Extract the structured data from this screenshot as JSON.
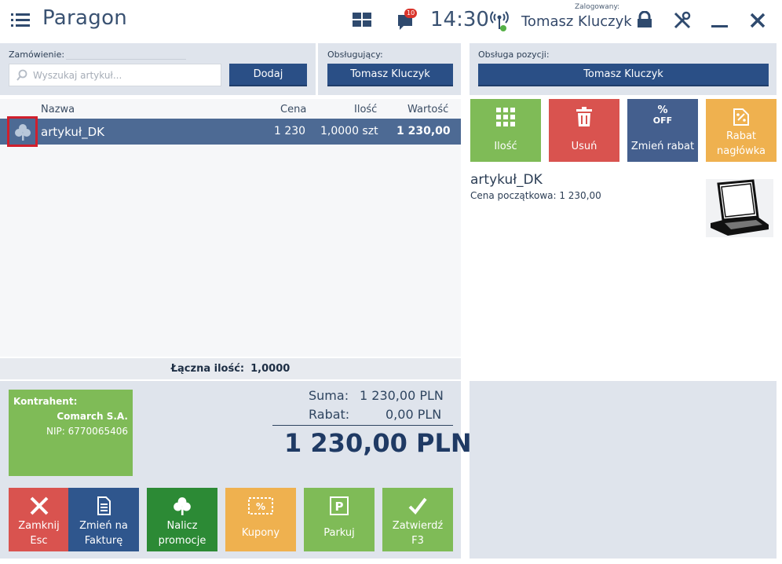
{
  "header": {
    "title": "Paragon",
    "notifications_count": "10",
    "clock": "14:30",
    "logged_label": "Zalogowany:",
    "logged_user": "Tomasz Kluczyk"
  },
  "order": {
    "label": "Zamówienie:",
    "search_placeholder": "Wyszukaj artykuł...",
    "add_button": "Dodaj"
  },
  "serving": {
    "label": "Obsługujący:",
    "user_button": "Tomasz Kluczyk"
  },
  "position_service": {
    "label": "Obsługa pozycji:",
    "user_button": "Tomasz Kluczyk"
  },
  "table": {
    "columns": [
      "Nazwa",
      "Cena",
      "Ilość",
      "Wartość"
    ],
    "rows": [
      {
        "name": "artykuł_DK",
        "price": "1 230",
        "quantity": "1,0000 szt",
        "value": "1 230,00"
      }
    ]
  },
  "totals": {
    "quantity_label": "Łączna ilość:",
    "quantity_value": "1,0000",
    "sum_label": "Suma:",
    "sum_value": "1 230,00 PLN",
    "discount_label": "Rabat:",
    "discount_value": "0,00 PLN",
    "grand_total": "1 230,00 PLN"
  },
  "contractor": {
    "label": "Kontrahent:",
    "name": "Comarch S.A.",
    "nip": "NIP: 6770065406"
  },
  "actions": [
    {
      "line1": "Zamknij",
      "line2": "Esc",
      "color": "#d9534f"
    },
    {
      "line1": "Zmień na",
      "line2": "Fakturę",
      "color": "#2f568d"
    },
    {
      "line1": "Nalicz",
      "line2": "promocje",
      "color": "#2c8a35"
    },
    {
      "line1": "Kupony",
      "line2": "",
      "color": "#efb14f"
    },
    {
      "line1": "Parkuj",
      "line2": "",
      "color": "#7fbb57"
    },
    {
      "line1": "Zatwierdź",
      "line2": "F3",
      "color": "#7fbb57"
    }
  ],
  "tiles": [
    {
      "line1": "Ilość",
      "line2": "",
      "color": "#7fbb57"
    },
    {
      "line1": "Usuń",
      "line2": "",
      "color": "#d9534f"
    },
    {
      "line1": "Zmień rabat",
      "line2": "",
      "color": "#445f8e",
      "icon_text": "OFF"
    },
    {
      "line1": "Rabat",
      "line2": "nagłówka",
      "color": "#efb14f"
    }
  ],
  "item_detail": {
    "name": "artykuł_DK",
    "start_price_label": "Cena początkowa: 1 230,00"
  },
  "colors": {
    "accent_blue": "#2a4f86",
    "panel_bg": "#dfe4ec",
    "selected_row": "#4d6a94",
    "highlight_border": "#d01f2d"
  }
}
